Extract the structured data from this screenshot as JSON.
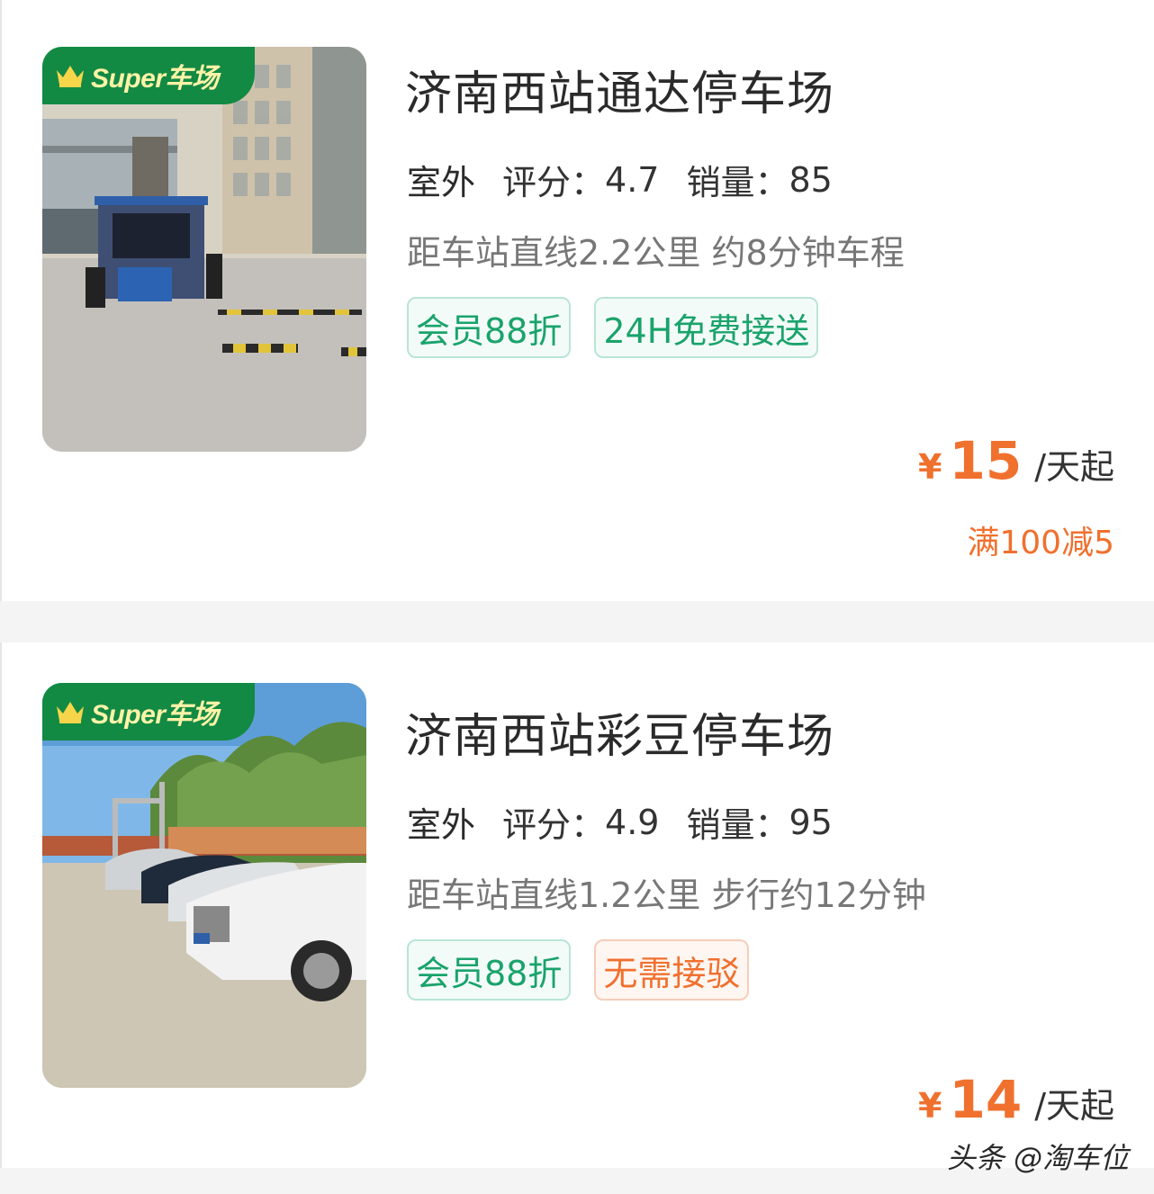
{
  "badge_text": "Super车场",
  "listings": [
    {
      "title": "济南西站通达停车场",
      "type": "室外",
      "rating_label": "评分：",
      "rating": "4.7",
      "sales_label": "销量：",
      "sales": "85",
      "distance": "距车站直线2.2公里 约8分钟车程",
      "tags": [
        "会员88折",
        "24H免费接送"
      ],
      "currency": "¥",
      "price": "15",
      "price_unit": "/天起",
      "promo": "满100减5"
    },
    {
      "title": "济南西站彩豆停车场",
      "type": "室外",
      "rating_label": "评分：",
      "rating": "4.9",
      "sales_label": "销量：",
      "sales": "95",
      "distance": "距车站直线1.2公里 步行约12分钟",
      "tags": [
        "会员88折",
        "无需接驳"
      ],
      "currency": "¥",
      "price": "14",
      "price_unit": "/天起"
    }
  ],
  "watermark": "头条 @淘车位",
  "colors": {
    "accent": "#f0702e",
    "green": "#1aa36c",
    "badge": "#128a43"
  }
}
